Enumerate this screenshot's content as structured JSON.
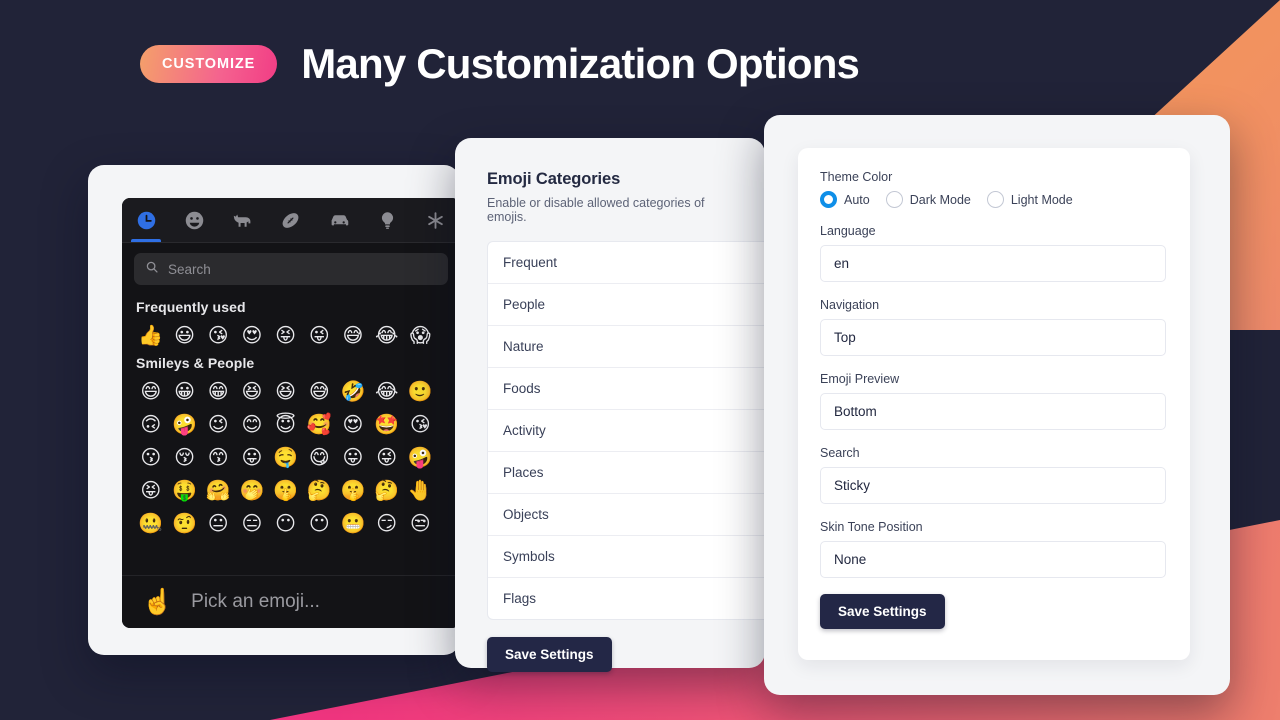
{
  "header": {
    "badge_label": "CUSTOMIZE",
    "title": "Many Customization Options",
    "badge_gradient_from": "#f4a06a",
    "badge_gradient_to": "#f23d85",
    "background_color": "#212338"
  },
  "picker": {
    "tabs": [
      {
        "icon": "clock-icon",
        "active": true
      },
      {
        "icon": "smiley-icon",
        "active": false
      },
      {
        "icon": "dog-icon",
        "active": false
      },
      {
        "icon": "football-icon",
        "active": false
      },
      {
        "icon": "car-icon",
        "active": false
      },
      {
        "icon": "lightbulb-icon",
        "active": false
      },
      {
        "icon": "asterisk-icon",
        "active": false
      }
    ],
    "search_placeholder": "Search",
    "search_icon": "search-icon",
    "groups": [
      {
        "title": "Frequently used",
        "rows": [
          [
            "👍",
            "😃",
            "😘",
            "😍",
            "😝",
            "😜",
            "😅",
            "😂",
            "😱"
          ]
        ]
      },
      {
        "title": "Smileys & People",
        "rows": [
          [
            "😄",
            "😀",
            "😁",
            "😆",
            "😆",
            "😅",
            "🤣",
            "😂",
            "🙂"
          ],
          [
            "🙃",
            "🤪",
            "😉",
            "😊",
            "😇",
            "🥰",
            "😍",
            "🤩",
            "😘"
          ],
          [
            "😗",
            "😚",
            "😙",
            "😛",
            "🤤",
            "😋",
            "😛",
            "😜",
            "🤪"
          ],
          [
            "😝",
            "🤑",
            "🤗",
            "🤭",
            "🤫",
            "🤔",
            "🤫",
            "🤔",
            "🤚"
          ],
          [
            "🤐",
            "🤨",
            "😐",
            "😑",
            "😶",
            "😶",
            "😬",
            "😏",
            "😒"
          ]
        ]
      }
    ],
    "preview_emoji": "☝️",
    "preview_text": "Pick an emoji..."
  },
  "categories_panel": {
    "title": "Emoji Categories",
    "subtitle": "Enable or disable allowed categories of emojis.",
    "items": [
      {
        "label": "Frequent"
      },
      {
        "label": "People"
      },
      {
        "label": "Nature"
      },
      {
        "label": "Foods"
      },
      {
        "label": "Activity"
      },
      {
        "label": "Places"
      },
      {
        "label": "Objects"
      },
      {
        "label": "Symbols"
      },
      {
        "label": "Flags"
      }
    ],
    "save_label": "Save Settings"
  },
  "settings_panel": {
    "theme_color_label": "Theme Color",
    "theme_options": [
      {
        "label": "Auto",
        "selected": true
      },
      {
        "label": "Dark Mode",
        "selected": false
      },
      {
        "label": "Light Mode",
        "selected": false
      }
    ],
    "accent_color": "#0f8fe8",
    "fields": [
      {
        "label": "Language",
        "value": "en"
      },
      {
        "label": "Navigation",
        "value": "Top"
      },
      {
        "label": "Emoji Preview",
        "value": "Bottom"
      },
      {
        "label": "Search",
        "value": "Sticky"
      },
      {
        "label": "Skin Tone Position",
        "value": "None"
      }
    ],
    "save_label": "Save Settings"
  }
}
